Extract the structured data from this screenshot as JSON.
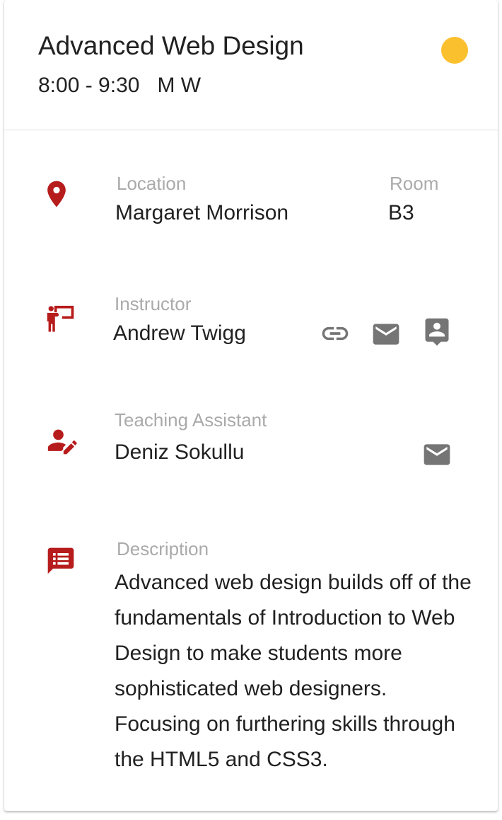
{
  "course": {
    "title": "Advanced Web Design",
    "schedule": "8:00 - 9:30   M W",
    "status_color": "#FBC02D"
  },
  "accent_color": "#B71C1C",
  "icon_gray": "#757575",
  "location": {
    "icon": "location-pin-icon",
    "label": "Location",
    "value": "Margaret Morrison",
    "room_label": "Room",
    "room_value": "B3"
  },
  "instructor": {
    "icon": "instructor-icon",
    "label": "Instructor",
    "name": "Andrew Twigg",
    "actions": [
      "link-icon",
      "email-icon",
      "contact-icon"
    ]
  },
  "teaching_assistant": {
    "icon": "ta-edit-person-icon",
    "label": "Teaching Assistant",
    "name": "Deniz Sokullu",
    "actions": [
      "email-icon"
    ]
  },
  "description": {
    "icon": "description-icon",
    "label": "Description",
    "text": "Advanced web design builds off of the fundamentals of Introduction to Web Design to make students more sophisticated web designers. Focusing on furthering skills through the HTML5 and CSS3."
  }
}
